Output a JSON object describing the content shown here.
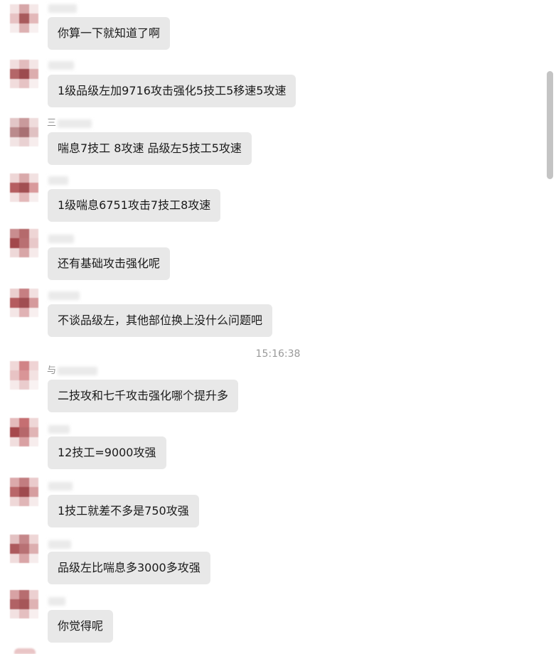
{
  "timestamp": "15:16:38",
  "messages": [
    {
      "sender": "",
      "text": "你算一下就知道了啊",
      "avatar_colors": [
        "#f3e2e2",
        "#d7a6a8",
        "#f5e8e8",
        "#e7c2c3",
        "#a85a5c",
        "#e3b8b9",
        "#f6ecec",
        "#ddb1b2",
        "#f8f0f0"
      ]
    },
    {
      "sender": "",
      "text": "1级品级左加9716攻击强化5技工5移速5攻速",
      "avatar_colors": [
        "#f1dede",
        "#e2bcbd",
        "#f4e6e6",
        "#b46668",
        "#9c4b4e",
        "#dcadae",
        "#f1dcdc",
        "#e6c3c4",
        "#f8efef"
      ]
    },
    {
      "sender": "三",
      "text": "喘息7技工 8攻速 品级左5技工5攻速",
      "avatar_colors": [
        "#e2c6c7",
        "#c99a9c",
        "#efdcdc",
        "#bb8a8c",
        "#a87073",
        "#e0c1c2",
        "#f2e4e4",
        "#e9d1d2",
        "#f7eded"
      ]
    },
    {
      "sender": "",
      "text": "1级喘息6751攻击7技工8攻速",
      "avatar_colors": [
        "#eed6d6",
        "#d9a9aa",
        "#f2e1e1",
        "#b65e61",
        "#a24f52",
        "#d99a9c",
        "#f3e3e3",
        "#e3b8b9",
        "#f7eeee"
      ]
    },
    {
      "sender": "",
      "text": "还有基础攻击强化呢",
      "avatar_colors": [
        "#c98d8f",
        "#b56a6c",
        "#eed5d5",
        "#a2474b",
        "#b96f72",
        "#e8c8c9",
        "#eed8d8",
        "#d8a6a7",
        "#f6eaea"
      ]
    },
    {
      "sender": "",
      "text": "不谈品级左，其他部位换上没什么问题吧",
      "avatar_colors": [
        "#ebcfcf",
        "#c67f82",
        "#f2e0e0",
        "#b55c5f",
        "#a04d51",
        "#d59a9c",
        "#f4e6e6",
        "#e0b2b4",
        "#f8efef"
      ]
    },
    {
      "sender": "与",
      "text": "二技攻和七千攻击强化哪个提升多",
      "avatar_colors": [
        "#f0d8d8",
        "#d18386",
        "#efd3d4",
        "#e8c3c4",
        "#d99597",
        "#f3e2e2",
        "#f6eaea",
        "#eacccd",
        "#f9f2f2"
      ]
    },
    {
      "sender": "",
      "text": "12技工=9000攻强",
      "avatar_colors": [
        "#e4bbbc",
        "#c56f72",
        "#eed7d7",
        "#a6484c",
        "#b6676a",
        "#e0b4b5",
        "#f1dede",
        "#d9a1a3",
        "#f7eded"
      ]
    },
    {
      "sender": "",
      "text": "1技工就差不多是750攻强",
      "avatar_colors": [
        "#dba9ab",
        "#c27d80",
        "#eacbcc",
        "#b96669",
        "#9f4a4e",
        "#d69ea0",
        "#efd8d8",
        "#e0b6b7",
        "#f6ebeb"
      ]
    },
    {
      "sender": "",
      "text": "品级左比喘息多3000多攻强",
      "avatar_colors": [
        "#e3c1c2",
        "#c5878a",
        "#eed6d6",
        "#ad5a5d",
        "#b87174",
        "#dcaeaf",
        "#f0dcdc",
        "#d9a5a7",
        "#f6ecec"
      ]
    },
    {
      "sender": "",
      "text": "你觉得呢",
      "avatar_colors": [
        "#d8a2a4",
        "#b76d70",
        "#ecd0d1",
        "#b16265",
        "#a65659",
        "#dfb3b4",
        "#f2e1e1",
        "#e4bfc0",
        "#f8efef"
      ]
    }
  ]
}
